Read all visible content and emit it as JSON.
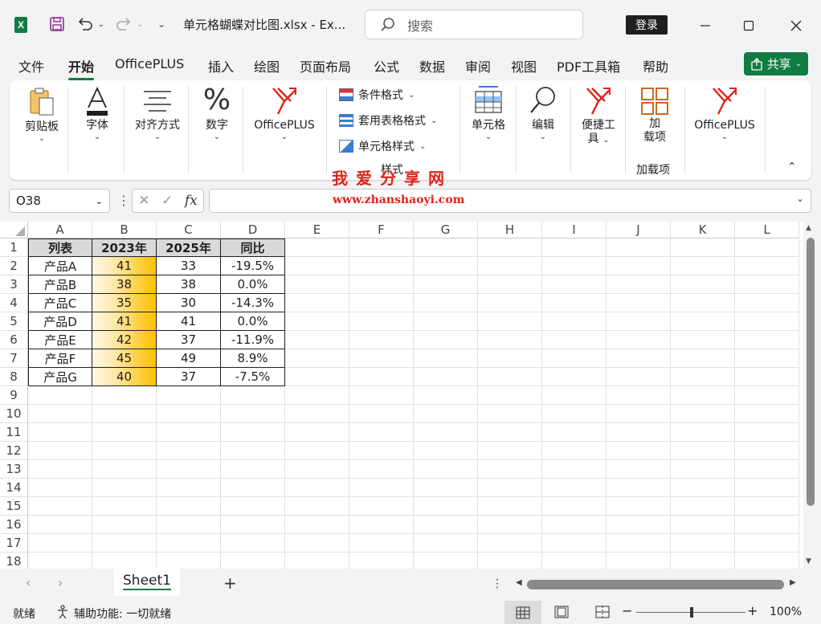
{
  "title": {
    "filename": "单元格蝴蝶对比图.xlsx  -  Ex...",
    "search_placeholder": "搜索",
    "login_label": "登录"
  },
  "menu": {
    "tabs": [
      "文件",
      "开始",
      "OfficePLUS",
      "插入",
      "绘图",
      "页面布局",
      "公式",
      "数据",
      "审阅",
      "视图",
      "PDF工具箱",
      "帮助"
    ],
    "active": "开始",
    "share_label": "共享"
  },
  "ribbon": {
    "clipboard": "剪贴板",
    "font": "字体",
    "alignment": "对齐方式",
    "number": "数字",
    "officeplus1": "OfficePLUS",
    "conditional_format": "条件格式",
    "table_format": "套用表格格式",
    "cell_style": "单元格样式",
    "styles_group": "样式",
    "cells": "单元格",
    "editing": "编辑",
    "tools_line1": "便捷工",
    "tools_line2": "具",
    "addin_line1": "加",
    "addin_line2": "载项",
    "addin_group": "加载项",
    "officeplus2": "OfficePLUS"
  },
  "watermark": {
    "line1": "我爱分享网",
    "line2": "www.zhanshaoyi.com"
  },
  "formula_bar": {
    "name_box": "O38",
    "fx": "fx"
  },
  "grid": {
    "columns": [
      "A",
      "B",
      "C",
      "D",
      "E",
      "F",
      "G",
      "H",
      "I",
      "J",
      "K",
      "L"
    ],
    "rows": [
      "1",
      "2",
      "3",
      "4",
      "5",
      "6",
      "7",
      "8",
      "9",
      "10",
      "11",
      "12",
      "13",
      "14",
      "15",
      "16",
      "17",
      "18"
    ],
    "header": [
      "列表",
      "2023年",
      "2025年",
      "同比"
    ],
    "data": [
      [
        "产品A",
        "41",
        "33",
        "-19.5%"
      ],
      [
        "产品B",
        "38",
        "38",
        "0.0%"
      ],
      [
        "产品C",
        "35",
        "30",
        "-14.3%"
      ],
      [
        "产品D",
        "41",
        "41",
        "0.0%"
      ],
      [
        "产品E",
        "42",
        "37",
        "-11.9%"
      ],
      [
        "产品F",
        "45",
        "49",
        "8.9%"
      ],
      [
        "产品G",
        "40",
        "37",
        "-7.5%"
      ]
    ],
    "bar_color": "#ffc000",
    "header_fill": "#d9d9d9"
  },
  "sheets": {
    "tabs": [
      "Sheet1"
    ],
    "add_label": "+"
  },
  "status": {
    "ready": "就绪",
    "accessibility": "辅助功能: 一切就绪",
    "zoom": "100%"
  },
  "colors": {
    "accent": "#107c41",
    "watermark": "#e2231a"
  }
}
